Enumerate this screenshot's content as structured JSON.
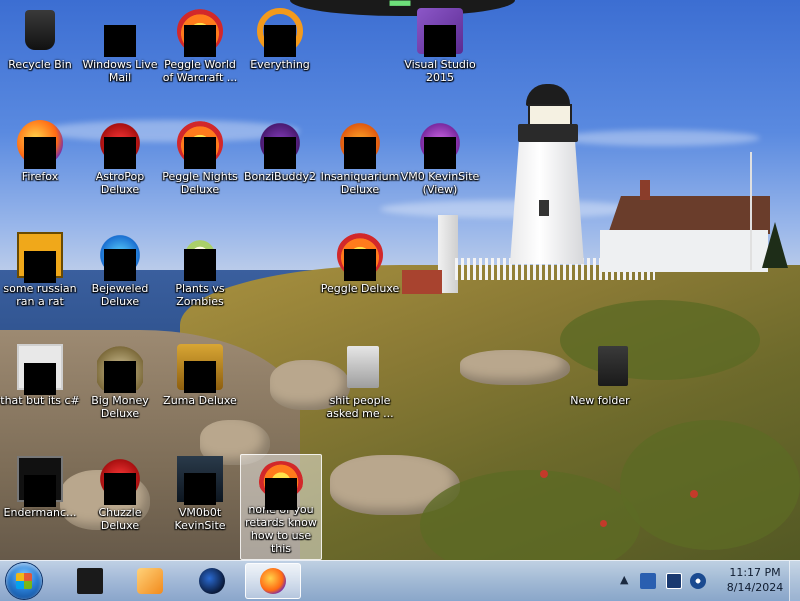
{
  "desktop": {
    "icons": [
      {
        "label": "Recycle Bin",
        "icon": "recycle-bin-icon"
      },
      {
        "label": "Windows Live Mail",
        "icon": "mail-icon"
      },
      {
        "label": "Peggle World of Warcraft ...",
        "icon": "peggle-icon"
      },
      {
        "label": "Everything",
        "icon": "search-ring-icon"
      },
      {
        "label": "Visual Studio 2015",
        "icon": "visual-studio-icon"
      },
      {
        "label": "Firefox",
        "icon": "firefox-icon"
      },
      {
        "label": "AstroPop Deluxe",
        "icon": "astropop-icon"
      },
      {
        "label": "Peggle Nights Deluxe",
        "icon": "peggle-icon"
      },
      {
        "label": "BonziBuddy2",
        "icon": "bonzibuddy-icon"
      },
      {
        "label": "Insaniquarium Deluxe",
        "icon": "fish-icon"
      },
      {
        "label": "VM0 KevinSite (View)",
        "icon": "vm-icon"
      },
      {
        "label": "some russian ran a rat",
        "icon": "document-icon"
      },
      {
        "label": "Bejeweled Deluxe",
        "icon": "gem-icon"
      },
      {
        "label": "Plants vs Zombies",
        "icon": "flower-icon"
      },
      {
        "label": "Peggle Deluxe",
        "icon": "peggle-icon"
      },
      {
        "label": "that but its c#",
        "icon": "file-stack-icon"
      },
      {
        "label": "Big Money Deluxe",
        "icon": "money-pot-icon"
      },
      {
        "label": "Zuma Deluxe",
        "icon": "chest-icon"
      },
      {
        "label": "shit people asked me ...",
        "icon": "text-file-icon"
      },
      {
        "label": "New folder",
        "icon": "folder-icon"
      },
      {
        "label": "Endermanc...",
        "icon": "terminal-icon"
      },
      {
        "label": "Chuzzle Deluxe",
        "icon": "chuzzle-icon"
      },
      {
        "label": "VM0b0t KevinSite",
        "icon": "vm-icon"
      },
      {
        "label": "none of you retards know how to use this",
        "icon": "peggle-icon"
      }
    ]
  },
  "taskbar": {
    "start_button": "start-orb-icon",
    "pinned": [
      {
        "name": "terminal",
        "icon": "terminal-icon",
        "active": false
      },
      {
        "name": "media-player",
        "icon": "media-player-icon",
        "active": false
      },
      {
        "name": "browser-globe",
        "icon": "globe-icon",
        "active": false
      },
      {
        "name": "firefox",
        "icon": "firefox-icon",
        "active": true
      }
    ],
    "tray": {
      "overflow": "▲",
      "time": "11:17 PM",
      "date": "8/14/2024"
    }
  },
  "top_overlay": {
    "glyph": "▀▀▀"
  }
}
